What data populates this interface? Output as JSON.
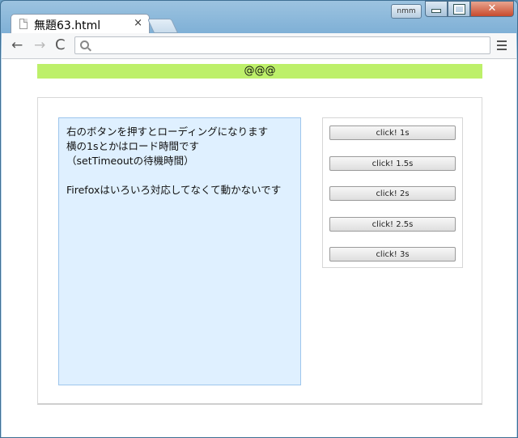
{
  "window": {
    "tab_title": "無題63.html",
    "tab_close": "×",
    "user_badge": "nmm",
    "close_glyph": "✕"
  },
  "toolbar": {
    "back": "←",
    "forward": "→",
    "reload": "C",
    "address_value": ""
  },
  "page": {
    "header": "@@@",
    "info_lines": [
      "右のボタンを押すとローディングになります",
      "横の1sとかはロード時間です",
      "（setTimeoutの待機時間）",
      "",
      "Firefoxはいろいろ対応してなくて動かないです"
    ],
    "buttons": [
      "click! 1s",
      "click! 1.5s",
      "click! 2s",
      "click! 2.5s",
      "click! 3s"
    ]
  },
  "colors": {
    "header_bg": "#bdf06a",
    "panel_bg": "#dff0ff",
    "panel_border": "#9ec6ec"
  }
}
